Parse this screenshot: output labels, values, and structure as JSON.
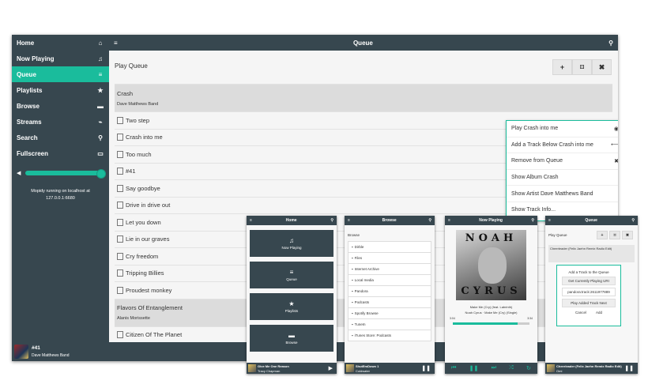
{
  "sidebar": {
    "items": [
      {
        "label": "Home",
        "icon": "home-icon",
        "glyph": "⌂"
      },
      {
        "label": "Now Playing",
        "icon": "music-icon",
        "glyph": "♫"
      },
      {
        "label": "Queue",
        "icon": "list-icon",
        "glyph": "≡"
      },
      {
        "label": "Playlists",
        "icon": "star-icon",
        "glyph": "★"
      },
      {
        "label": "Browse",
        "icon": "folder-icon",
        "glyph": "▬"
      },
      {
        "label": "Streams",
        "icon": "rss-icon",
        "glyph": "⌁"
      },
      {
        "label": "Search",
        "icon": "search-icon",
        "glyph": "⚲"
      },
      {
        "label": "Fullscreen",
        "icon": "monitor-icon",
        "glyph": "▭"
      }
    ],
    "active": "Queue",
    "volume_level": 1.0,
    "status_line1": "Mopidy running on localhost at",
    "status_line2": "127.0.0.1:6680"
  },
  "header": {
    "title": "Queue",
    "menu_glyph": "≡",
    "search_glyph": "⚲"
  },
  "queue": {
    "heading": "Play Queue",
    "buttons": [
      "+",
      "⌑",
      "✖"
    ],
    "tracks": [
      {
        "title": "Crash",
        "artist": "Dave Matthews Band",
        "selected": true
      },
      {
        "title": "Two step"
      },
      {
        "title": "Crash into me"
      },
      {
        "title": "Too much"
      },
      {
        "title": "#41"
      },
      {
        "title": "Say goodbye"
      },
      {
        "title": "Drive in drive out"
      },
      {
        "title": "Let you down"
      },
      {
        "title": "Lie in our graves"
      },
      {
        "title": "Cry freedom"
      },
      {
        "title": "Tripping Billies"
      },
      {
        "title": "Proudest monkey"
      },
      {
        "title": "Flavors Of Entanglement",
        "artist": "Alanis Morissette",
        "selected": true
      },
      {
        "title": "Citizen Of The Planet"
      }
    ]
  },
  "context_menu": {
    "items": [
      {
        "label": "Play Crash into me",
        "glyph": "◉"
      },
      {
        "label": "Add a Track Below Crash into me",
        "glyph": "⟵"
      },
      {
        "label": "Remove from Queue",
        "glyph": "✖"
      },
      {
        "label": "Show Album Crash",
        "glyph": ""
      },
      {
        "label": "Show Artist Dave Matthews Band",
        "glyph": ""
      },
      {
        "label": "Show Track Info...",
        "glyph": ""
      }
    ]
  },
  "now_playing": {
    "title": "#41",
    "artist": "Dave Matthews Band"
  },
  "mobile": {
    "home": {
      "title": "Home",
      "tiles": [
        {
          "label": "Now Playing",
          "glyph": "♫"
        },
        {
          "label": "Queue",
          "glyph": "≡"
        },
        {
          "label": "Playlists",
          "glyph": "★"
        },
        {
          "label": "Browse",
          "glyph": "▬"
        }
      ],
      "np_title": "Give Me One Reason",
      "np_artist": "Tracy Chapman"
    },
    "browse": {
      "title": "Browse",
      "heading": "Browse",
      "items": [
        "Dirble",
        "Files",
        "Internet Archive",
        "Local media",
        "Pandora",
        "Podcasts",
        "Spotify Browse",
        "TuneIn",
        "iTunes Store: Podcasts"
      ],
      "np_title": "ShutEmDown 1",
      "np_artist": "Coldwater"
    },
    "now_playing": {
      "title": "Now Playing",
      "cover_top": "NOAH",
      "cover_bottom": "CYRUS",
      "song": "Make Me (Cry) (feat. Labrinth)",
      "sub": "Noah Cyrus · Make Me (Cry) (Single)",
      "time_left": "3:04",
      "time_right": "3:34",
      "progress": 0.85
    },
    "queue": {
      "title": "Queue",
      "heading": "Play Queue",
      "track1": "Cheerleader (Felix Jaehn Remix Radio Edit)",
      "dialog_title": "Add a Track to the Queue",
      "dialog_get": "Get Currently Playing URI",
      "dialog_uri": "pandora:track:2611977889",
      "dialog_play": "Play Added Track Next",
      "dialog_cancel": "Cancel",
      "dialog_add": "Add",
      "np_title": "Cheerleader (Felix Jaehn Remix Radio Edit)",
      "np_artist": "Omi"
    }
  }
}
